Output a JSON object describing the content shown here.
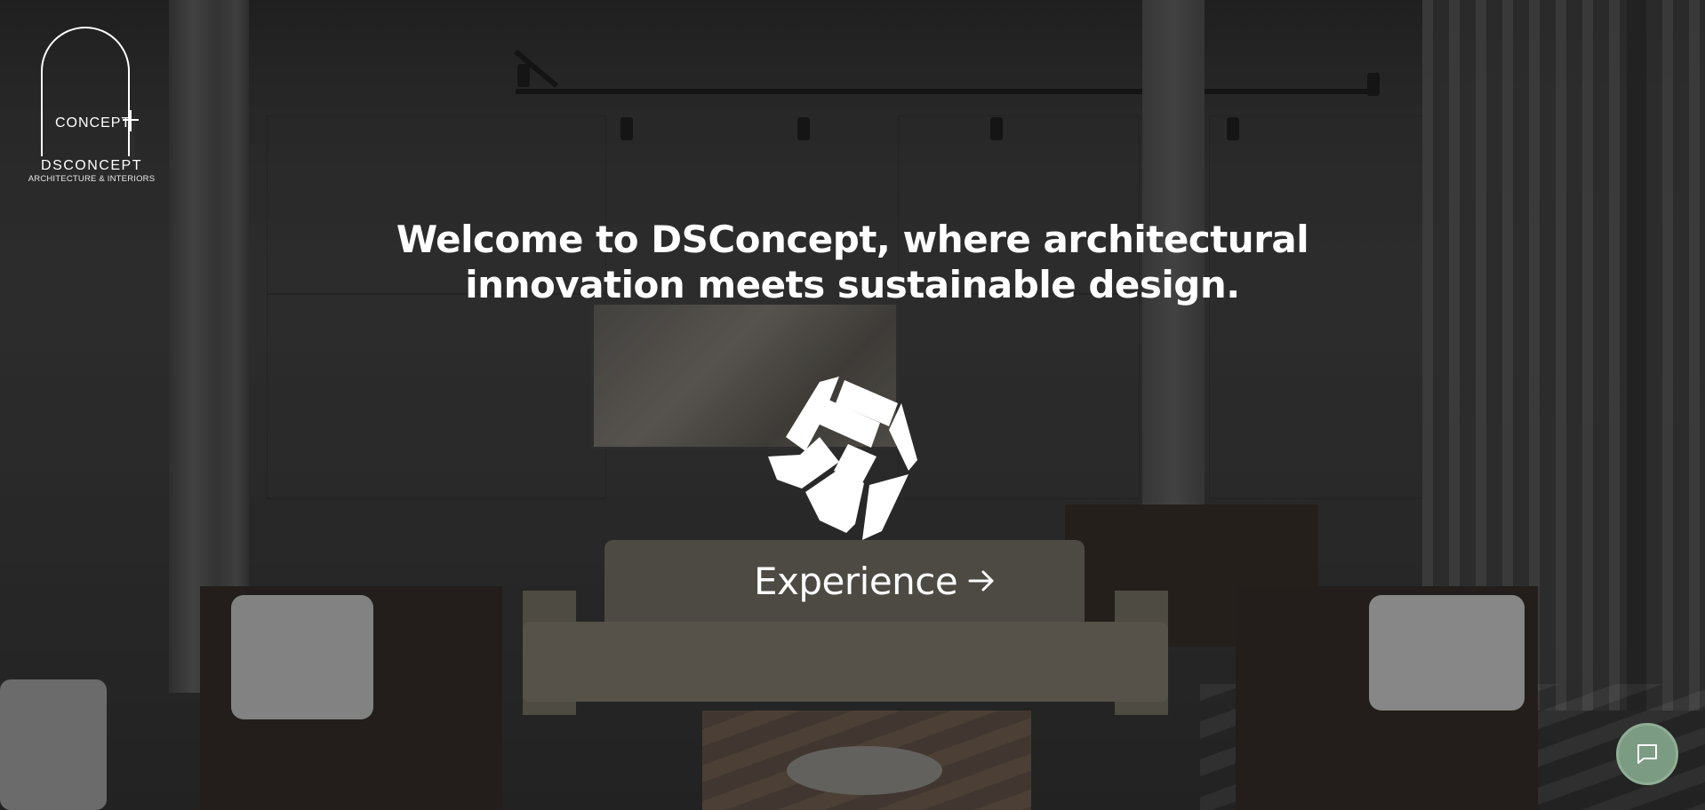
{
  "logo": {
    "mark_text": "CONCEPT",
    "brand": "DSCONCEPT",
    "tagline": "ARCHITECTURE & INTERIORS"
  },
  "hero": {
    "headline_line1": "Welcome to DSConcept, where architectural",
    "headline_line2": "innovation meets sustainable design.",
    "cta_label": "Experience",
    "cta_icon": "arrow-right-icon",
    "center_icon": "cube-icon"
  },
  "chat": {
    "icon": "chat-bubble-icon",
    "color": "#7b9b82"
  },
  "colors": {
    "text": "#ffffff",
    "chat_accent": "#7b9b82"
  }
}
